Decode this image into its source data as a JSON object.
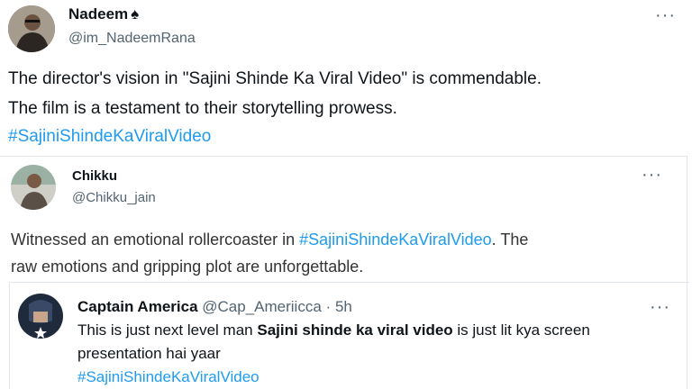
{
  "tweet1": {
    "name": "Nadeem",
    "handle": "@im_NadeemRana",
    "more": "···",
    "text_line1": "The director's vision in \"Sajini Shinde Ka Viral Video\" is commendable.",
    "text_line2": "The film is a testament to their storytelling prowess.",
    "hashtag": "#SajiniShindeKaViralVideo",
    "badge_icon": "spade-icon"
  },
  "tweet2": {
    "name": "Chikku",
    "handle": "@Chikku_jain",
    "more": "···",
    "text_pre": "Witnessed an emotional rollercoaster in ",
    "hashtag": "#SajiniShindeKaViralVideo",
    "text_post": ". The",
    "text_line2": "raw emotions and gripping plot are unforgettable."
  },
  "tweet3": {
    "name": "Captain America",
    "handle": "@Cap_Ameriicca",
    "sep": "·",
    "time": "5h",
    "more": "···",
    "text_pre": "This is just next level man ",
    "text_bold": "Sajini shinde ka viral video",
    "text_post": " is just lit kya screen",
    "text_line2": "presentation hai yaar",
    "hashtag": "#SajiniShindeKaViralVideo"
  },
  "colors": {
    "link": "#1d9bf0",
    "text": "#0f1419",
    "muted": "#536471",
    "divider": "#e1e6ea"
  }
}
